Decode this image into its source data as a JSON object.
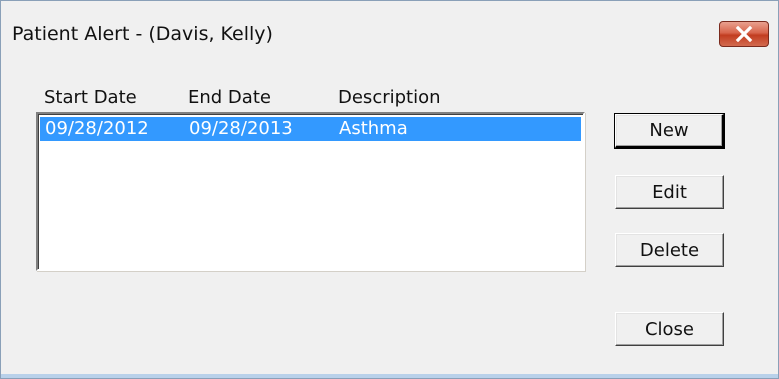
{
  "window": {
    "title": "Patient Alert - (Davis, Kelly)"
  },
  "list": {
    "columns": [
      "Start Date",
      "End Date",
      "Description"
    ],
    "rows": [
      {
        "start_date": "09/28/2012",
        "end_date": "09/28/2013",
        "description": "Asthma",
        "selected": true
      }
    ]
  },
  "buttons": {
    "new": "New",
    "edit": "Edit",
    "delete": "Delete",
    "close": "Close"
  },
  "colors": {
    "selection": "#3399ff",
    "close_button": "#c7462b"
  }
}
